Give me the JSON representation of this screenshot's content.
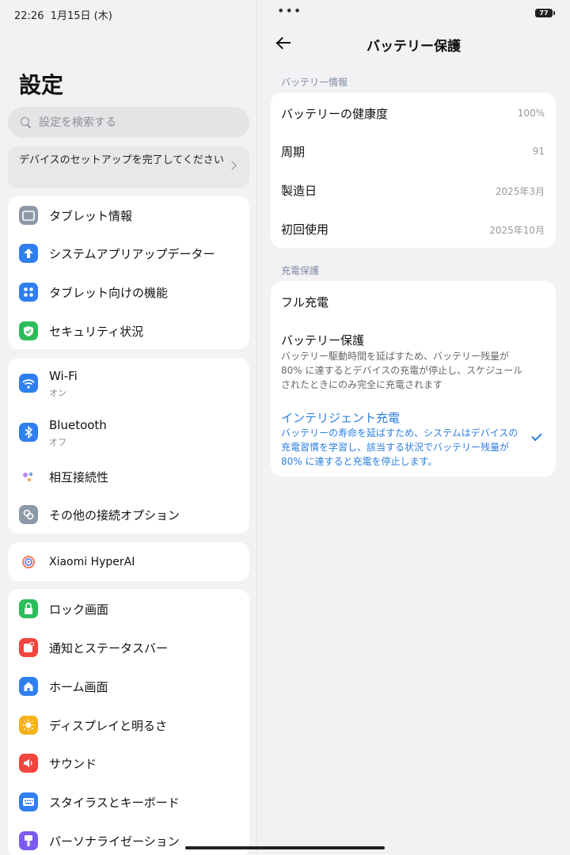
{
  "status": {
    "time": "22:26",
    "date": "1月15日 (木)",
    "battery": "77",
    "dots": "•••"
  },
  "left": {
    "title": "設定",
    "search_placeholder": "設定を検索する",
    "setup_banner": "デバイスのセットアップを完了してください",
    "groups": [
      {
        "items": [
          {
            "label": "タブレット情報",
            "icon": "tablet-icon",
            "color": "#8e99a8"
          },
          {
            "label": "システムアプリアップデーター",
            "icon": "arrow-up-icon",
            "color": "#2f7ff0"
          },
          {
            "label": "タブレット向けの機能",
            "icon": "grid-icon",
            "color": "#2f7ff0"
          },
          {
            "label": "セキュリティ状況",
            "icon": "shield-check-icon",
            "color": "#2cbd5a"
          }
        ]
      },
      {
        "items": [
          {
            "label": "Wi-Fi",
            "sub": "オン",
            "icon": "wifi-icon",
            "color": "#2f7ff0"
          },
          {
            "label": "Bluetooth",
            "sub": "オフ",
            "icon": "bluetooth-icon",
            "color": "#2f7ff0"
          },
          {
            "label": "相互接続性",
            "icon": "interconnect-icon",
            "color": "#ffffff"
          },
          {
            "label": "その他の接続オプション",
            "icon": "link-icon",
            "color": "#8e99a8"
          }
        ]
      },
      {
        "items": [
          {
            "label": "Xiaomi HyperAI",
            "icon": "hyperai-icon",
            "color": "#ffffff"
          }
        ]
      },
      {
        "items": [
          {
            "label": "ロック画面",
            "icon": "lock-icon",
            "color": "#2cbd5a"
          },
          {
            "label": "通知とステータスバー",
            "icon": "notification-icon",
            "color": "#f2453d"
          },
          {
            "label": "ホーム画面",
            "icon": "home-icon",
            "color": "#2f7ff0"
          },
          {
            "label": "ディスプレイと明るさ",
            "icon": "sun-icon",
            "color": "#f6b21b"
          },
          {
            "label": "サウンド",
            "icon": "speaker-icon",
            "color": "#f2453d"
          },
          {
            "label": "スタイラスとキーボード",
            "icon": "keyboard-icon",
            "color": "#2f7ff0"
          },
          {
            "label": "パーソナライゼーション",
            "icon": "paintbrush-icon",
            "color": "#7c5cf0"
          }
        ]
      }
    ]
  },
  "detail": {
    "title": "バッテリー保護",
    "section_info": "バッテリー情報",
    "info_rows": [
      {
        "key": "バッテリーの健康度",
        "value": "100%"
      },
      {
        "key": "周期",
        "value": "91"
      },
      {
        "key": "製造日",
        "value": "2025年3月"
      },
      {
        "key": "初回使用",
        "value": "2025年10月"
      }
    ],
    "section_charge": "充電保護",
    "full_charge": "フル充電",
    "protect_title": "バッテリー保護",
    "protect_desc": "バッテリー駆動時間を延ばすため、バッテリー残量が 80% に達するとデバイスの充電が停止し、スケジュールされたときにのみ完全に充電されます",
    "smart_title": "インテリジェント充電",
    "smart_desc": "バッテリーの寿命を延ばすため、システムはデバイスの充電習慣を学習し、該当する状況でバッテリー残量が 80% に達すると充電を停止します。",
    "accent": "#2b7fe0"
  }
}
